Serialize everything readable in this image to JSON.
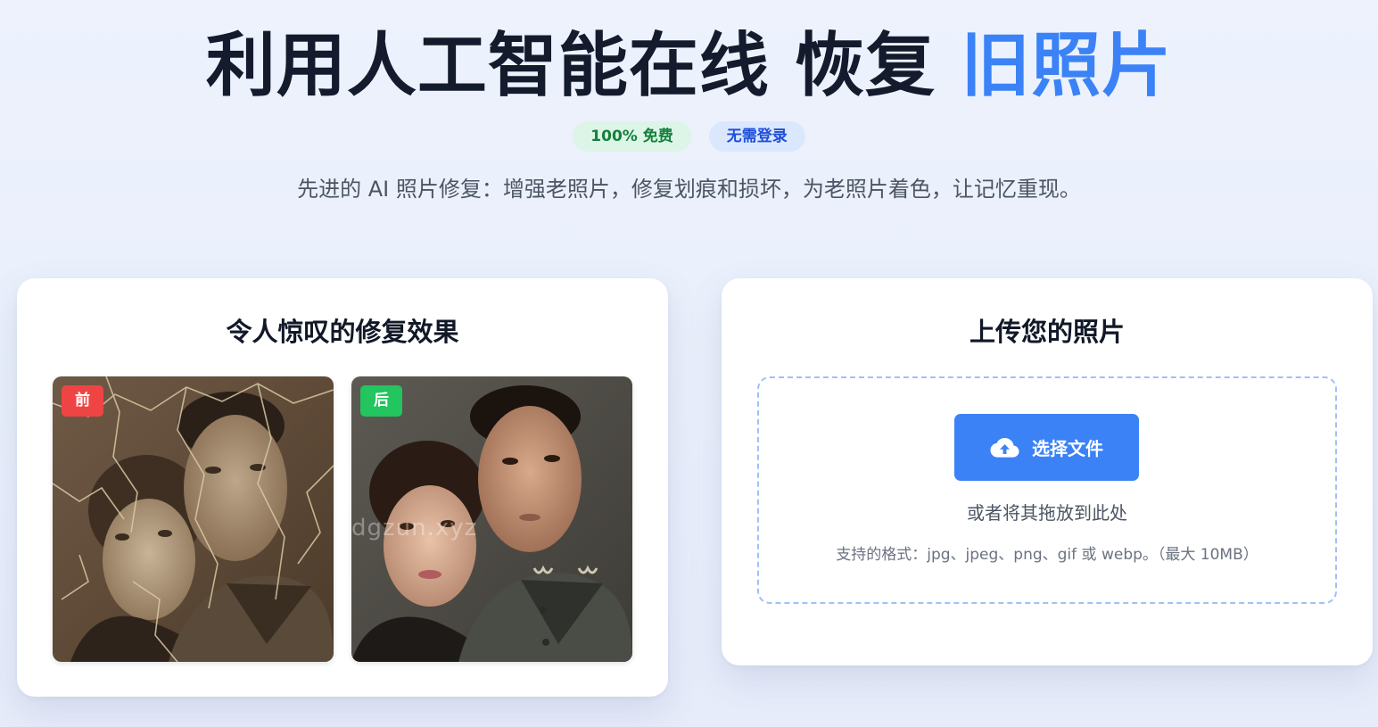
{
  "hero": {
    "title_main": "利用人工智能在线 恢复 ",
    "title_accent": "旧照片",
    "badges": [
      "100% 免费",
      "无需登录"
    ],
    "subtitle": "先进的 AI 照片修复：增强老照片，修复划痕和损坏，为老照片着色，让记忆重现。"
  },
  "showcase": {
    "title": "令人惊叹的修复效果",
    "before_tag": "前",
    "after_tag": "后",
    "watermark": "dgzun.xyz"
  },
  "upload": {
    "title": "上传您的照片",
    "button_label": "选择文件",
    "button_icon": "cloud-upload-icon",
    "drop_hint": "或者将其拖放到此处",
    "formats": "支持的格式：jpg、jpeg、png、gif 或 webp。（最大 10MB）"
  },
  "colors": {
    "accent": "#3b82f6",
    "before_tag": "#ef4444",
    "after_tag": "#22c55e",
    "free_badge_text": "#15803d",
    "login_badge_text": "#1d4ed8"
  }
}
